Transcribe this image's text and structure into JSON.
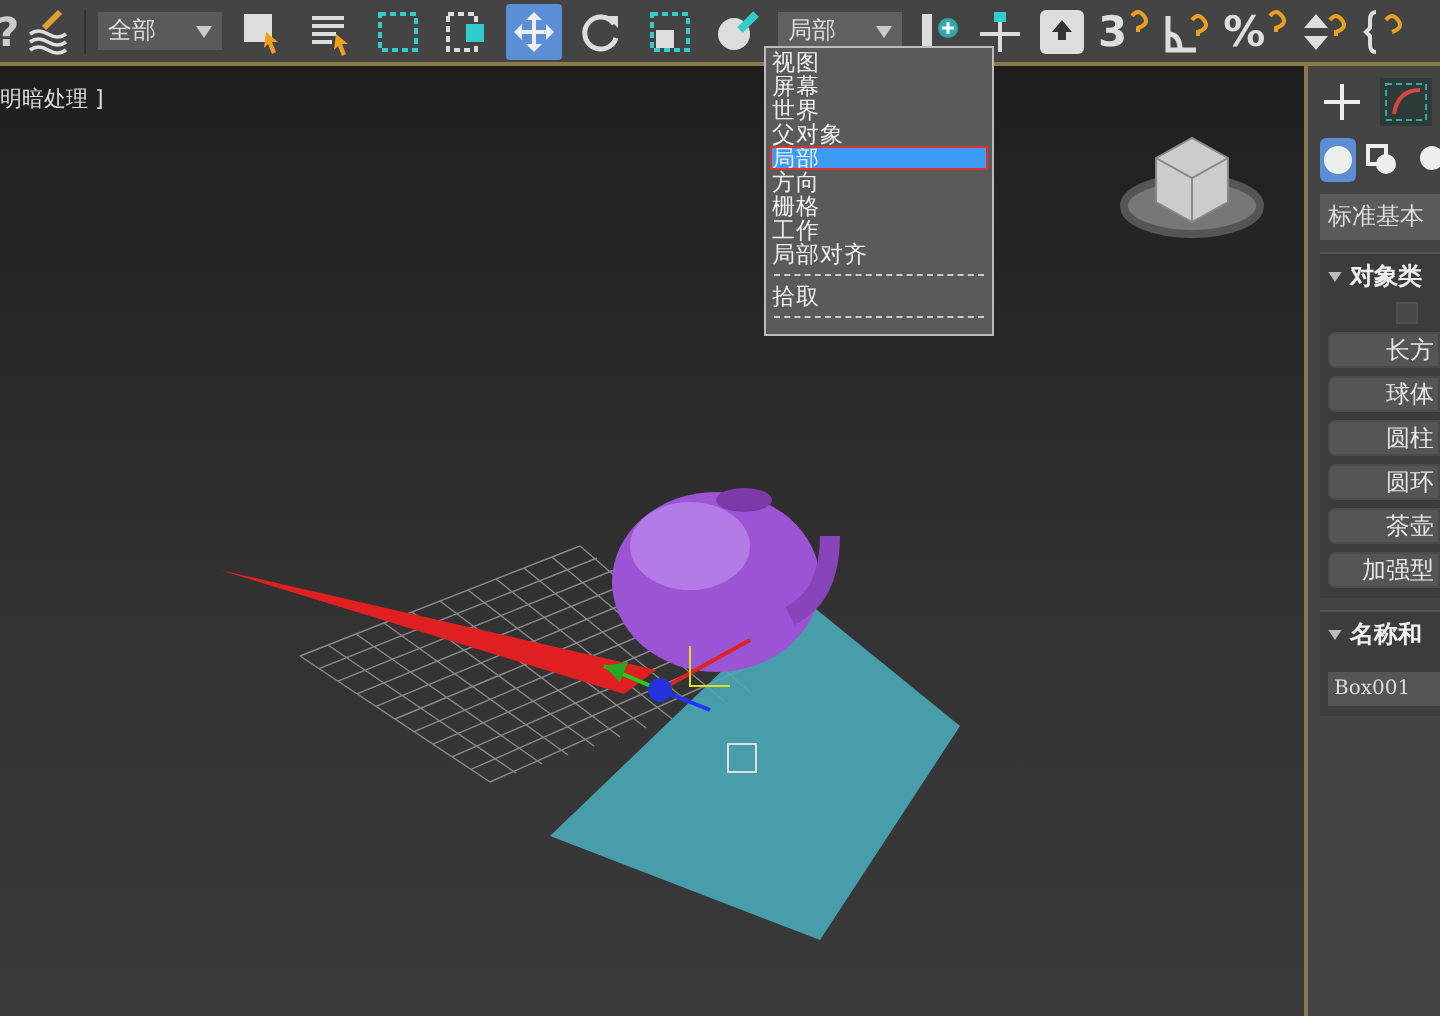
{
  "toolbar": {
    "left_glyph": "?",
    "filter_dropdown": "全部",
    "tools": [
      {
        "kind": "select",
        "selected": false
      },
      {
        "kind": "select-by-name",
        "selected": false
      },
      {
        "kind": "region",
        "selected": false
      },
      {
        "kind": "crossing",
        "selected": false
      },
      {
        "kind": "move",
        "selected": true
      },
      {
        "kind": "rotate",
        "selected": false
      },
      {
        "kind": "scale",
        "selected": false
      },
      {
        "kind": "place",
        "selected": false
      }
    ],
    "reference_dropdown": {
      "value": "局部",
      "open": true
    },
    "snaps": [
      {
        "kind": "pivot"
      },
      {
        "kind": "axis"
      },
      {
        "kind": "lock"
      },
      {
        "kind": "snap",
        "glyph": "3"
      },
      {
        "kind": "angle"
      },
      {
        "kind": "snap",
        "glyph": "%"
      },
      {
        "kind": "spinner"
      },
      {
        "kind": "braces"
      }
    ]
  },
  "reference_menu": [
    {
      "kind": "option",
      "label": "视图",
      "selected": false
    },
    {
      "kind": "option",
      "label": "屏幕",
      "selected": false
    },
    {
      "kind": "option",
      "label": "世界",
      "selected": false
    },
    {
      "kind": "option",
      "label": "父对象",
      "selected": false
    },
    {
      "kind": "option",
      "label": "局部",
      "selected": true
    },
    {
      "kind": "option",
      "label": "方向",
      "selected": false
    },
    {
      "kind": "option",
      "label": "栅格",
      "selected": false
    },
    {
      "kind": "option",
      "label": "工作",
      "selected": false
    },
    {
      "kind": "option",
      "label": "局部对齐",
      "selected": false
    },
    {
      "kind": "separator"
    },
    {
      "kind": "option",
      "label": "拾取",
      "selected": false
    },
    {
      "kind": "separator"
    }
  ],
  "viewport": {
    "label": "明暗处理 ]"
  },
  "command_panel": {
    "tabs": [
      {
        "kind": "create"
      },
      {
        "kind": "modify"
      }
    ],
    "categories": [
      {
        "kind": "geometry",
        "selected": true
      },
      {
        "kind": "shapes",
        "selected": false
      },
      {
        "kind": "lights",
        "selected": false
      }
    ],
    "type_dropdown": "标准基本",
    "object_type": {
      "title": "对象类",
      "autogrid": {
        "checked": false,
        "disabled": true
      },
      "buttons": [
        "长方",
        "球体",
        "圆柱",
        "圆环",
        "茶壶",
        "加强型"
      ]
    },
    "name_color": {
      "title": "名称和",
      "name": "Box001"
    }
  }
}
